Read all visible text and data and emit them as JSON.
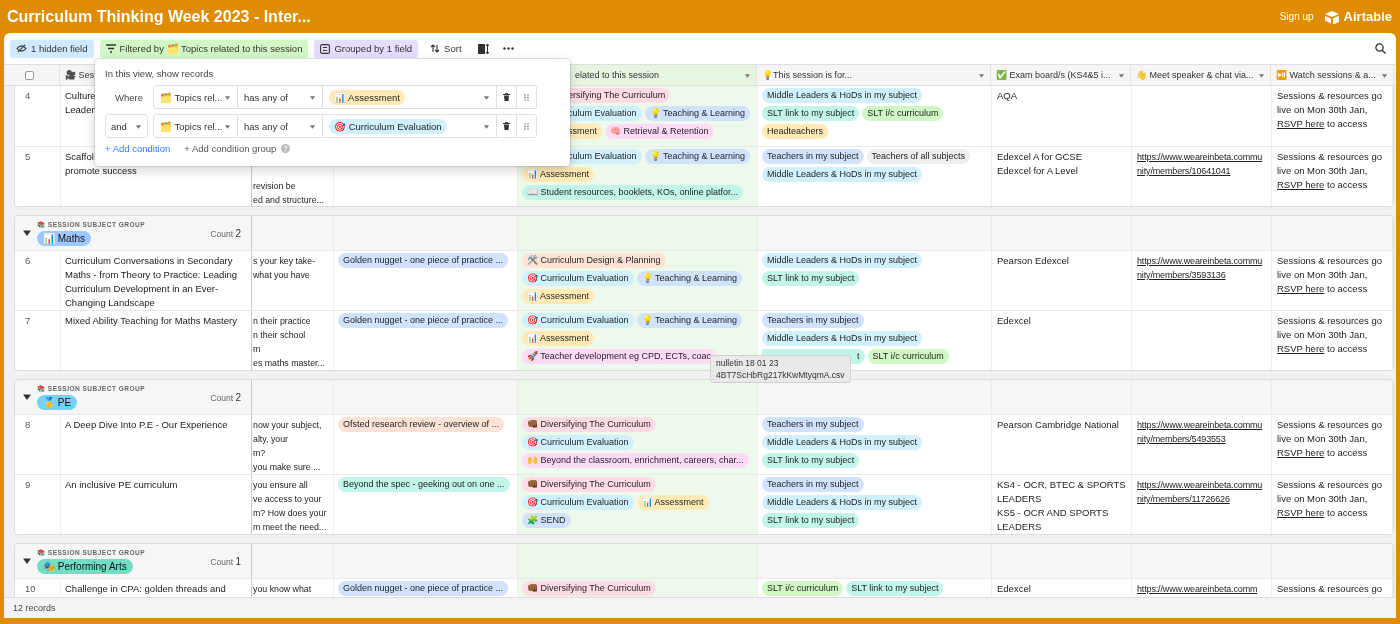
{
  "app": {
    "title": "Curriculum Thinking Week 2023 - Inter...",
    "sign_up": "Sign up",
    "brand": "Airtable"
  },
  "toolbar": {
    "hidden_fields": "1 hidden field",
    "filter": "Filtered by 🗂️ Topics related to this session",
    "group": "Grouped by 1 field",
    "sort": "Sort"
  },
  "filter_popup": {
    "heading": "In this view, show records",
    "conditions": [
      {
        "kind": "label",
        "conjunction": "Where",
        "field": "🗂️ Topics rel...",
        "operator": "has any of",
        "value": {
          "label": "📊 Assessment",
          "color": "#ffeab6"
        }
      },
      {
        "kind": "dropdown",
        "conjunction": "and",
        "field": "🗂️ Topics rel...",
        "operator": "has any of",
        "value": {
          "label": "🎯 Curriculum Evaluation",
          "color": "#d0f0fd"
        }
      }
    ],
    "add_condition": "+ Add condition",
    "add_group": "+ Add condition group"
  },
  "table": {
    "select_all": {
      "checked": false
    },
    "columns": [
      {
        "label": "🎥 Ses",
        "filtered": false
      },
      {
        "label": "elated to this session",
        "menu": true,
        "filtered": true
      },
      {
        "label": "💡This session is for...",
        "menu": true,
        "filtered": false
      },
      {
        "label": "✅ Exam board/s (KS4&5 i...",
        "menu": true,
        "filtered": false
      },
      {
        "label": "👋 Meet speaker & chat via...",
        "menu": true,
        "filtered": false
      },
      {
        "label": "⏯️ Watch sessions & a...",
        "menu": true,
        "filtered": false
      }
    ],
    "groups": [
      {
        "rows": [
          {
            "number": "4",
            "title": "Culture\nLeader",
            "topics": [
              {
                "kind": "cut",
                "label": "ersifying The Curriculum",
                "color": "#ffdce5"
              },
              {
                "kind": "cut",
                "label": "culum Evaluation",
                "color": "#d0f0fd"
              },
              {
                "kind": "tag",
                "label": "💡 Teaching & Learning",
                "color": "#d1e2ff"
              },
              {
                "kind": "cut",
                "label": "ssment",
                "color": "#ffeab6"
              },
              {
                "kind": "tag",
                "label": "🧠 Retrieval & Retention",
                "color": "#ffdaf6"
              }
            ],
            "audience": [
              {
                "kind": "tag",
                "label": "Middle Leaders & HoDs in my subject",
                "color": "#d0f0fd"
              },
              {
                "kind": "tag",
                "label": "SLT link to my subject",
                "color": "#c2f5e9"
              },
              {
                "kind": "tag",
                "label": "SLT i/c curriculum",
                "color": "#d1f7c4"
              },
              {
                "kind": "tag",
                "label": "Headteachers",
                "color": "#ffeab6"
              }
            ],
            "exam": "AQA",
            "watch": {
              "text": "Sessions & resources go live on Mon 30th Jan,",
              "link": "RSVP here",
              "after": "to access"
            }
          },
          {
            "number": "5",
            "title": "Scaffol\npromote success",
            "column_2": "revision be\ned and structure...",
            "topics": [
              {
                "kind": "cut",
                "label": "culum Evaluation",
                "color": "#d0f0fd"
              },
              {
                "kind": "tag",
                "label": "💡 Teaching & Learning",
                "color": "#d1e2ff"
              },
              {
                "kind": "tag",
                "label": "📊 Assessment",
                "color": "#ffeab6"
              },
              {
                "kind": "tag",
                "label": "📖 Student resources, booklets, KOs, online platfor...",
                "color": "#c2f5e9"
              }
            ],
            "audience": [
              {
                "kind": "tag",
                "label": "Teachers in my subject",
                "color": "#d1e2ff"
              },
              {
                "kind": "tag",
                "label": "Teachers of all subjects",
                "color": "#eeeeee"
              },
              {
                "kind": "tag",
                "label": "Middle Leaders & HoDs in my subject",
                "color": "#d0f0fd"
              }
            ],
            "exam": "Edexcel A for GCSE\nEdexcel for A Level",
            "speaker": "https://www.weareinbeta.community/members/10641041",
            "watch": {
              "text": "Sessions & resources go live on Mon 30th Jan,",
              "link": "RSVP here",
              "after": "to access"
            }
          }
        ]
      },
      {
        "header": {
          "caption": "📚 SESSION SUBJECT GROUP",
          "label": "📊 Maths",
          "color": "#9cc7ff",
          "count_label": "Count",
          "count": "2",
          "expanded": true
        },
        "rows": [
          {
            "number": "6",
            "title": "Curriculum Conversations in Secondary Maths - from Theory to Practice: Leading Curriculum Development in an Ever-Changing Landscape",
            "column_2": "s your key take-\nwhat you have",
            "column_3": [
              {
                "kind": "tag",
                "label": "Golden nugget - one piece of practice ...",
                "color": "#d1e2ff"
              }
            ],
            "topics": [
              {
                "kind": "tag",
                "label": "🛠️ Curriculum Design & Planning",
                "color": "#fee2d5"
              },
              {
                "kind": "tag",
                "label": "🎯 Curriculum Evaluation",
                "color": "#d0f0fd"
              },
              {
                "kind": "tag",
                "label": "💡 Teaching & Learning",
                "color": "#d1e2ff"
              },
              {
                "kind": "tag",
                "label": "📊 Assessment",
                "color": "#ffeab6"
              }
            ],
            "audience": [
              {
                "kind": "tag",
                "label": "Middle Leaders & HoDs in my subject",
                "color": "#d0f0fd"
              },
              {
                "kind": "tag",
                "label": "SLT link to my subject",
                "color": "#c2f5e9"
              }
            ],
            "exam": "Pearson Edexcel",
            "speaker": "https://www.weareinbeta.community/members/3593136",
            "watch": {
              "text": "Sessions & resources go live on Mon 30th Jan,",
              "link": "RSVP here",
              "after": "to access"
            }
          },
          {
            "number": "7",
            "title": "Mixed Ability Teaching for Maths Mastery",
            "column_2": "n their practice\nn their school\nm\nes maths master...",
            "column_3": [
              {
                "kind": "tag",
                "label": "Golden nugget - one piece of practice ...",
                "color": "#d1e2ff"
              }
            ],
            "topics": [
              {
                "kind": "tag",
                "label": "🎯 Curriculum Evaluation",
                "color": "#d0f0fd"
              },
              {
                "kind": "tag",
                "label": "💡 Teaching & Learning",
                "color": "#d1e2ff"
              },
              {
                "kind": "tag",
                "label": "📊 Assessment",
                "color": "#ffeab6"
              },
              {
                "kind": "tag",
                "label": "🚀 Teacher development eg CPD, ECTs, coac",
                "color": "#ffdaf6"
              }
            ],
            "audience": [
              {
                "kind": "tag",
                "label": "Teachers in my subject",
                "color": "#d1e2ff"
              },
              {
                "kind": "tag",
                "label": "Middle Leaders & HoDs in my subject",
                "color": "#d0f0fd"
              },
              {
                "kind": "cut",
                "label": "t",
                "color": "#c2f5e9"
              },
              {
                "kind": "tag",
                "label": "SLT i/c curriculum",
                "color": "#d1f7c4"
              }
            ],
            "exam": "Edexcel",
            "watch": {
              "text": "Sessions & resources go live on Mon 30th Jan,",
              "link": "RSVP here",
              "after": "to access"
            }
          }
        ]
      },
      {
        "header": {
          "caption": "📚 SESSION SUBJECT GROUP",
          "label": "🥇 PE",
          "color": "#77d1f3",
          "count_label": "Count",
          "count": "2",
          "expanded": true
        },
        "rows": [
          {
            "number": "8",
            "title": "A Deep Dive Into P.E - Our Experience",
            "column_2": "now your subject,\nalty, your\nm?\nyou make sure ...",
            "column_3": [
              {
                "kind": "tag",
                "label": "Ofsted research review - overview of ...",
                "color": "#fee2d5"
              }
            ],
            "topics": [
              {
                "kind": "tag",
                "label": "👊🏾 Diversifying The Curriculum",
                "color": "#ffdce5"
              },
              {
                "kind": "tag",
                "label": "🎯 Curriculum Evaluation",
                "color": "#d0f0fd"
              },
              {
                "kind": "tag",
                "label": "🙌 Beyond the classroom, enrichment, careers, char...",
                "color": "#ffdaf6"
              }
            ],
            "audience": [
              {
                "kind": "tag",
                "label": "Teachers in my subject",
                "color": "#d1e2ff"
              },
              {
                "kind": "tag",
                "label": "Middle Leaders & HoDs in my subject",
                "color": "#d0f0fd"
              },
              {
                "kind": "tag",
                "label": "SLT link to my subject",
                "color": "#c2f5e9"
              }
            ],
            "exam": "Pearson Cambridge National",
            "speaker": "https://www.weareinbeta.community/members/5493553",
            "watch": {
              "text": "Sessions & resources go live on Mon 30th Jan,",
              "link": "RSVP here",
              "after": "to access"
            }
          },
          {
            "number": "9",
            "title": "An inclusive PE curriculum",
            "column_2": "you ensure all\nve access to your\nm? How does your\nm meet the need...",
            "column_3": [
              {
                "kind": "tag",
                "label": "Beyond the spec - geeking out on one ...",
                "color": "#c2f5e9"
              }
            ],
            "topics": [
              {
                "kind": "tag",
                "label": "👊🏾 Diversifying The Curriculum",
                "color": "#ffdce5"
              },
              {
                "kind": "tag",
                "label": "🎯 Curriculum Evaluation",
                "color": "#d0f0fd"
              },
              {
                "kind": "tag",
                "label": "📊 Assessment",
                "color": "#ffeab6"
              },
              {
                "kind": "tag",
                "label": "🧩 SEND",
                "color": "#d1e2ff"
              }
            ],
            "audience": [
              {
                "kind": "tag",
                "label": "Teachers in my subject",
                "color": "#d1e2ff"
              },
              {
                "kind": "tag",
                "label": "Middle Leaders & HoDs in my subject",
                "color": "#d0f0fd"
              },
              {
                "kind": "tag",
                "label": "SLT link to my subject",
                "color": "#c2f5e9"
              }
            ],
            "exam": "KS4 - OCR, BTEC & SPORTS LEADERS\nKS5 - OCR AND SPORTS LEADERS",
            "speaker": "https://www.weareinbeta.community/members/11726626",
            "watch": {
              "text": "Sessions & resources go live on Mon 30th Jan,",
              "link": "RSVP here",
              "after": "to access"
            }
          }
        ]
      },
      {
        "header": {
          "caption": "📚 SESSION SUBJECT GROUP",
          "label": "🎭 Performing Arts",
          "color": "#72ddc3",
          "count_label": "Count",
          "count": "1",
          "expanded": true
        },
        "rows": [
          {
            "number": "10",
            "title": "Challenge in CPA: golden threads and",
            "column_2": "you know what",
            "column_3": [
              {
                "kind": "tag",
                "label": "Golden nugget - one piece of practice ...",
                "color": "#d1e2ff"
              }
            ],
            "topics": [
              {
                "kind": "tag",
                "label": "👊🏾 Diversifying The Curriculum",
                "color": "#ffdce5"
              }
            ],
            "audience": [
              {
                "kind": "tag",
                "label": "SLT i/c curriculum",
                "color": "#d1f7c4"
              },
              {
                "kind": "tag",
                "label": "SLT link to my subject",
                "color": "#c2f5e9"
              }
            ],
            "exam": "Edexcel",
            "speaker": "https://www.weareinbeta.comm",
            "watch": {
              "text": "Sessions & resources go"
            }
          }
        ]
      }
    ],
    "record_count": "12 records"
  },
  "tooltip": "nulletin 18 01 23\n4BT7ScHbRg217kKwMtyqmA.csv"
}
